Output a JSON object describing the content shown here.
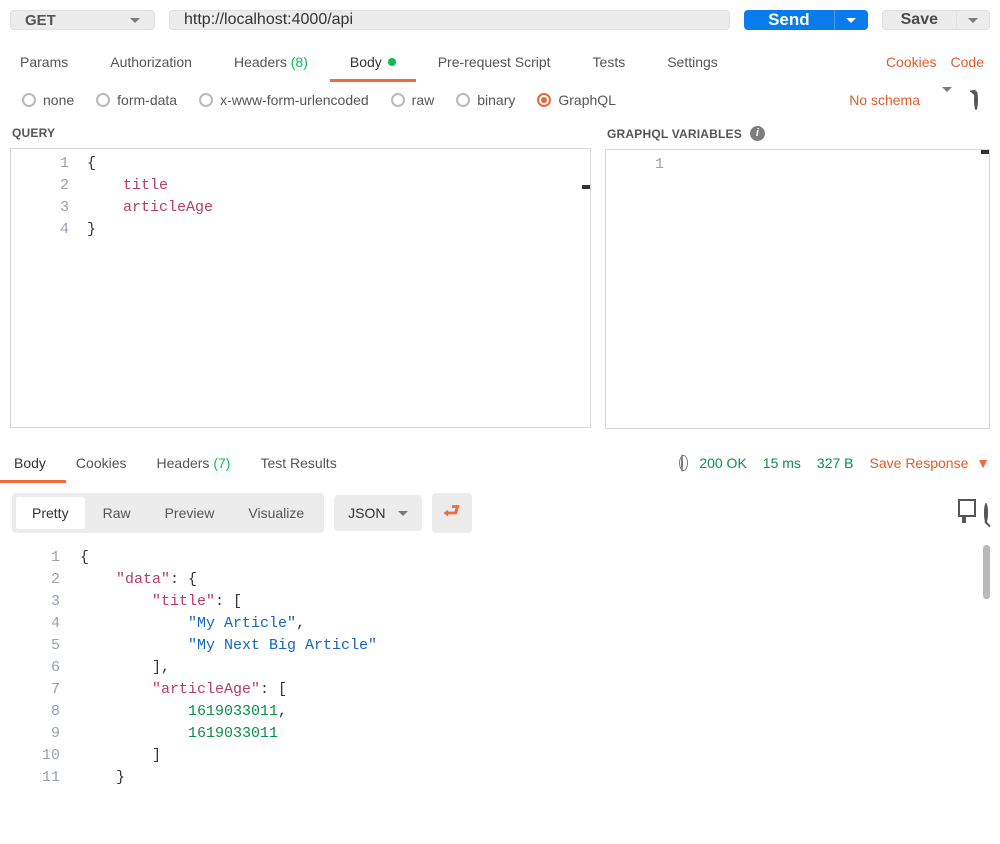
{
  "request": {
    "method": "GET",
    "url": "http://localhost:4000/api",
    "send_label": "Send",
    "save_label": "Save"
  },
  "req_tabs": {
    "params": "Params",
    "authorization": "Authorization",
    "headers": "Headers",
    "headers_count": "(8)",
    "body": "Body",
    "prerequest": "Pre-request Script",
    "tests": "Tests",
    "settings": "Settings",
    "cookies": "Cookies",
    "code": "Code"
  },
  "body_types": {
    "none": "none",
    "formdata": "form-data",
    "xwww": "x-www-form-urlencoded",
    "raw": "raw",
    "binary": "binary",
    "graphql": "GraphQL",
    "schema": "No schema"
  },
  "query_panel": {
    "title": "QUERY",
    "lines": [
      "1",
      "2",
      "3",
      "4"
    ],
    "l1": "{",
    "l2_indent": "    ",
    "l2": "title",
    "l3_indent": "    ",
    "l3": "articleAge",
    "l4": "}"
  },
  "vars_panel": {
    "title": "GRAPHQL VARIABLES",
    "lines": [
      "1"
    ]
  },
  "resp_tabs": {
    "body": "Body",
    "cookies": "Cookies",
    "headers": "Headers",
    "headers_count": "(7)",
    "testresults": "Test Results"
  },
  "status": {
    "code": "200 OK",
    "time": "15 ms",
    "size": "327 B",
    "save": "Save Response"
  },
  "view": {
    "pretty": "Pretty",
    "raw": "Raw",
    "preview": "Preview",
    "visualize": "Visualize",
    "format": "JSON"
  },
  "response": {
    "lines": [
      "1",
      "2",
      "3",
      "4",
      "5",
      "6",
      "7",
      "8",
      "9",
      "10",
      "11"
    ],
    "l1": "{",
    "k_data": "\"data\"",
    "k_title": "\"title\"",
    "v_t1": "\"My Article\"",
    "v_t2": "\"My Next Big Article\"",
    "k_age": "\"articleAge\"",
    "v_a1": "1619033011",
    "v_a2": "1619033011"
  },
  "chart_data": {
    "type": "table",
    "title": "GraphQL response",
    "series": [
      {
        "name": "title",
        "values": [
          "My Article",
          "My Next Big Article"
        ]
      },
      {
        "name": "articleAge",
        "values": [
          1619033011,
          1619033011
        ]
      }
    ]
  }
}
